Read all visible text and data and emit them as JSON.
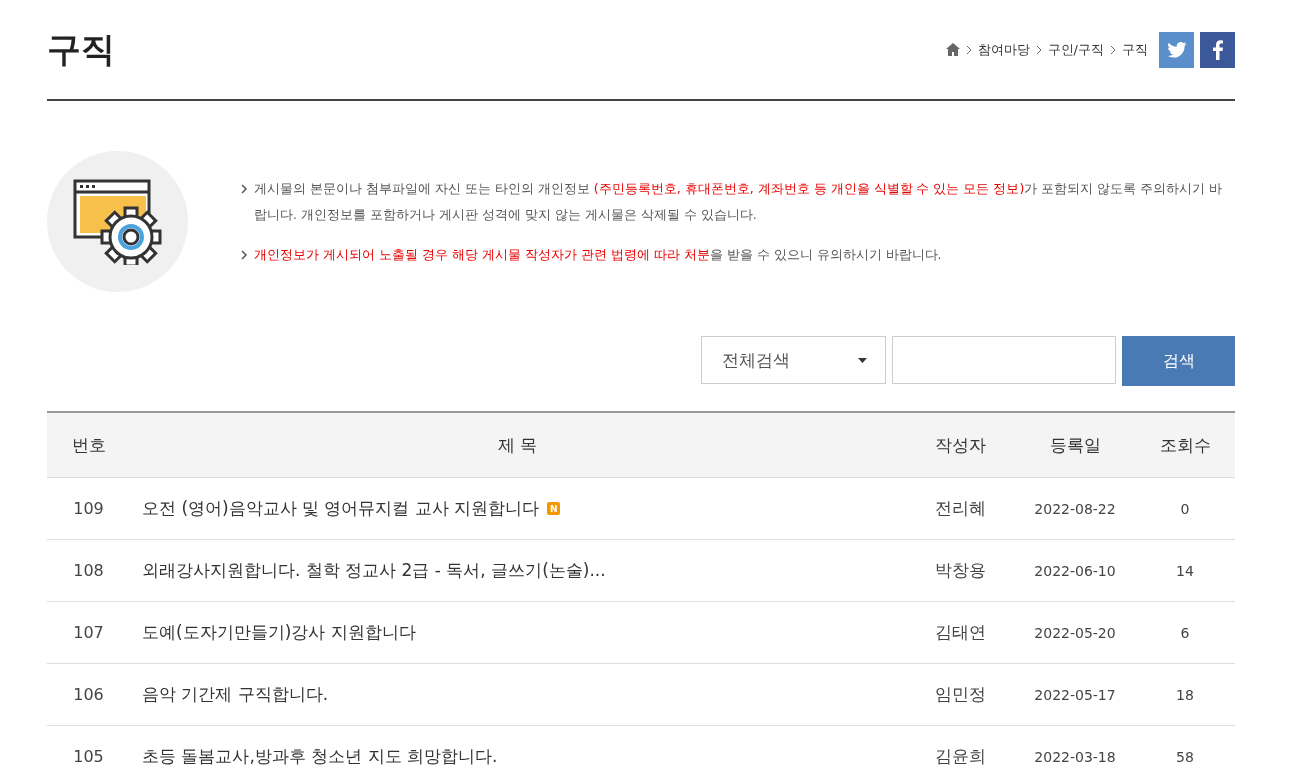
{
  "page_title": "구직",
  "breadcrumb": [
    "참여마당",
    "구인/구직",
    "구직"
  ],
  "notices": [
    {
      "segments": [
        {
          "text": "게시물의 본문이나 첨부파일에 자신 또는 타인의 개인정보 ",
          "highlight": false
        },
        {
          "text": "(주민등록번호, 휴대폰번호, 계좌번호 등 개인을 식별할 수 있는 모든 정보)",
          "highlight": true
        },
        {
          "text": "가 포함되지 않도록 주의하시기 바랍니다. 개인정보를 포함하거나 게시판 성격에 맞지 않는 게시물은 삭제될 수 있습니다.",
          "highlight": false
        }
      ]
    },
    {
      "segments": [
        {
          "text": "개인정보가 게시되어 노출될 경우 해당 게시물 작성자가 관련 법령에 따라 처분",
          "highlight": true
        },
        {
          "text": "을 받을 수 있으니 유의하시기 바랍니다.",
          "highlight": false
        }
      ]
    }
  ],
  "search": {
    "scope": "전체검색",
    "button": "검색"
  },
  "table": {
    "columns": [
      "번호",
      "제 목",
      "작성자",
      "등록일",
      "조회수"
    ],
    "rows": [
      {
        "no": "109",
        "title": "오전 (영어)음악교사 및 영어뮤지컬 교사 지원합니다",
        "badge": "N",
        "author": "전리혜",
        "date": "2022-08-22",
        "views": "0"
      },
      {
        "no": "108",
        "title": "외래강사지원합니다. 철학 정교사 2급 - 독서, 글쓰기(논술)...",
        "author": "박창용",
        "date": "2022-06-10",
        "views": "14"
      },
      {
        "no": "107",
        "title": "도예(도자기만들기)강사 지원합니다",
        "author": "김태연",
        "date": "2022-05-20",
        "views": "6"
      },
      {
        "no": "106",
        "title": "음악 기간제 구직합니다.",
        "author": "임민정",
        "date": "2022-05-17",
        "views": "18"
      },
      {
        "no": "105",
        "title": "초등 돌봄교사,방과후 청소년 지도 희망합니다.",
        "author": "김윤희",
        "date": "2022-03-18",
        "views": "58"
      }
    ]
  }
}
